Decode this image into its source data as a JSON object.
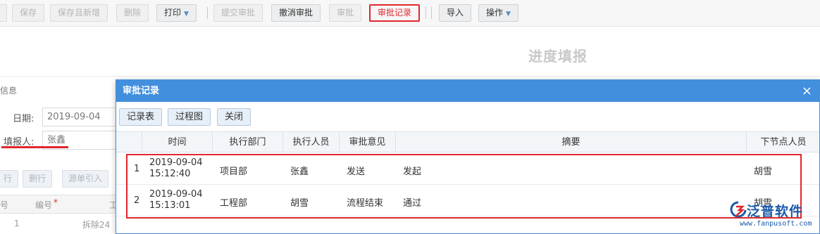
{
  "toolbar": {
    "buttons": [
      {
        "label": "",
        "state": "disabled"
      },
      {
        "label": "保存",
        "state": "disabled"
      },
      {
        "label": "保存且新增",
        "state": "disabled"
      },
      {
        "label": "删除",
        "state": "disabled"
      },
      {
        "label": "打印",
        "state": "active"
      },
      {
        "label": "提交审批",
        "state": "disabled"
      },
      {
        "label": "撤消审批",
        "state": "active"
      },
      {
        "label": "审批",
        "state": "disabled"
      },
      {
        "label": "审批记录",
        "state": "highlight"
      },
      {
        "label": "导入",
        "state": "active"
      },
      {
        "label": "操作",
        "state": "active"
      }
    ]
  },
  "page": {
    "title": "进度填报",
    "section_label": "信息"
  },
  "form": {
    "date_label": "日期:",
    "date_value": "2019-09-04",
    "reporter_label": "填报人:",
    "reporter_value": "张鑫"
  },
  "sub_toolbar": {
    "buttons": [
      "行",
      "删行",
      "源单引入"
    ]
  },
  "background_grid": {
    "header_col1": "号",
    "header_col2": "编号",
    "header_required_mark": "*",
    "header_col3": "工",
    "row_no": "1",
    "row_text": "拆除24"
  },
  "modal": {
    "title": "审批记录",
    "close_icon": "×",
    "buttons": [
      "记录表",
      "过程图",
      "关闭"
    ],
    "columns": [
      "时间",
      "执行部门",
      "执行人员",
      "审批意见",
      "摘要",
      "下节点人员"
    ],
    "rows": [
      {
        "no": "1",
        "date": "2019-09-04",
        "time": "15:12:40",
        "dept": "项目部",
        "person": "张鑫",
        "opinion": "发送",
        "summary": "发起",
        "next": "胡雪"
      },
      {
        "no": "2",
        "date": "2019-09-04",
        "time": "15:13:01",
        "dept": "工程部",
        "person": "胡雪",
        "opinion": "流程结束",
        "summary": "通过",
        "next": "胡雪"
      }
    ]
  },
  "watermark": {
    "brand": "泛普软件",
    "url": "www.fanpusoft.com",
    "icon": "fanpu-logo-icon"
  },
  "colors": {
    "modal_header": "#4290dd",
    "highlight_red": "#e1262d",
    "brand_blue": "#1a5aa8"
  }
}
